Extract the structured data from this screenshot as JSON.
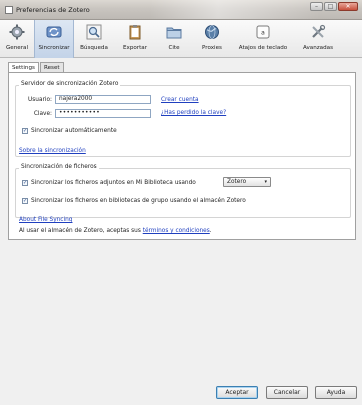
{
  "window": {
    "title": "Preferencias de Zotero",
    "minimize": "–",
    "maximize": "□",
    "close": "✕"
  },
  "toolbar": {
    "items": [
      {
        "label": "General",
        "icon": "gear-icon"
      },
      {
        "label": "Sincronizar",
        "icon": "sync-icon",
        "selected": true
      },
      {
        "label": "Búsqueda",
        "icon": "search-icon"
      },
      {
        "label": "Exportar",
        "icon": "clipboard-icon"
      },
      {
        "label": "Cite",
        "icon": "folder-icon"
      },
      {
        "label": "Proxies",
        "icon": "globe-icon"
      },
      {
        "label": "Atajos de teclado",
        "icon": "keyboard-key-icon"
      },
      {
        "label": "Avanzadas",
        "icon": "tools-icon"
      }
    ]
  },
  "tabs": [
    {
      "label": "Settings",
      "active": true
    },
    {
      "label": "Reset",
      "active": false
    }
  ],
  "server": {
    "title": "Servidor de sincronización Zotero",
    "username_label": "Usuario:",
    "username_value": "najera2000",
    "password_label": "Clave:",
    "password_value": "•••••••••••",
    "create_account": "Crear cuenta",
    "forgot_password": "¿Has perdido la clave?",
    "auto_sync_label": "Sincronizar automáticamente",
    "auto_sync_checked": true,
    "about_sync": "Sobre la sincronización"
  },
  "files": {
    "title": "Sincronización de ficheros",
    "library_label": "Sincronizar los ficheros adjuntos en Mi Biblioteca usando",
    "library_checked": true,
    "library_select": "Zotero",
    "group_label": "Sincronizar los ficheros en bibliotecas de grupo usando el almacén Zotero",
    "group_checked": true,
    "about_file_sync": "About File Syncing",
    "terms_prefix": "Al usar el almacén de Zotero, aceptas sus",
    "terms_link": "términos y condiciones",
    "terms_suffix": "."
  },
  "buttons": {
    "accept": "Aceptar",
    "cancel": "Cancelar",
    "help": "Ayuda"
  },
  "colors": {
    "link": "#1f3fbf",
    "selected_tab": "#c3d3e8",
    "default_button_border": "#3c7fb1"
  }
}
